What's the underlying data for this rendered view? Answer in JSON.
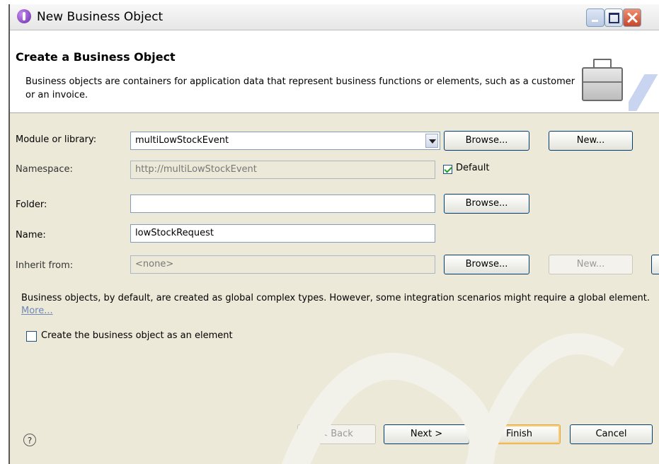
{
  "window": {
    "title": "New Business Object",
    "controls": [
      "minimize-icon",
      "maximize-icon",
      "close-icon"
    ]
  },
  "banner": {
    "heading": "Create a Business Object",
    "description": "Business objects are containers for application data that represent business functions or elements, such as a customer or an invoice.",
    "icon": "briefcase-icon"
  },
  "form": {
    "module_label": "Module or library:",
    "module_value": "multiLowStockEvent",
    "module_browse": "Browse...",
    "module_new": "New...",
    "namespace_label": "Namespace:",
    "namespace_value": "http://multiLowStockEvent",
    "default_label": "Default",
    "default_checked": true,
    "folder_label": "Folder:",
    "folder_value": "",
    "folder_browse": "Browse...",
    "name_label": "Name:",
    "name_value": "lowStockRequest",
    "inherit_label": "Inherit from:",
    "inherit_value": "<none>",
    "inherit_browse": "Browse...",
    "inherit_new": "New..."
  },
  "info": {
    "text": "Business objects, by default, are created as global complex types. However, some integration scenarios might require a global element.",
    "more_link": "More..."
  },
  "element_checkbox": {
    "label": "Create the business object as an element",
    "checked": false
  },
  "footer": {
    "help_icon": "help-icon",
    "help_glyph": "?",
    "back": "< Back",
    "next": "Next >",
    "finish": "Finish",
    "cancel": "Cancel"
  },
  "colors": {
    "dialog_bg": "#ece9d8",
    "banner_bg": "#ffffff",
    "link": "#6f88b8",
    "focus_border": "#e8a635"
  }
}
